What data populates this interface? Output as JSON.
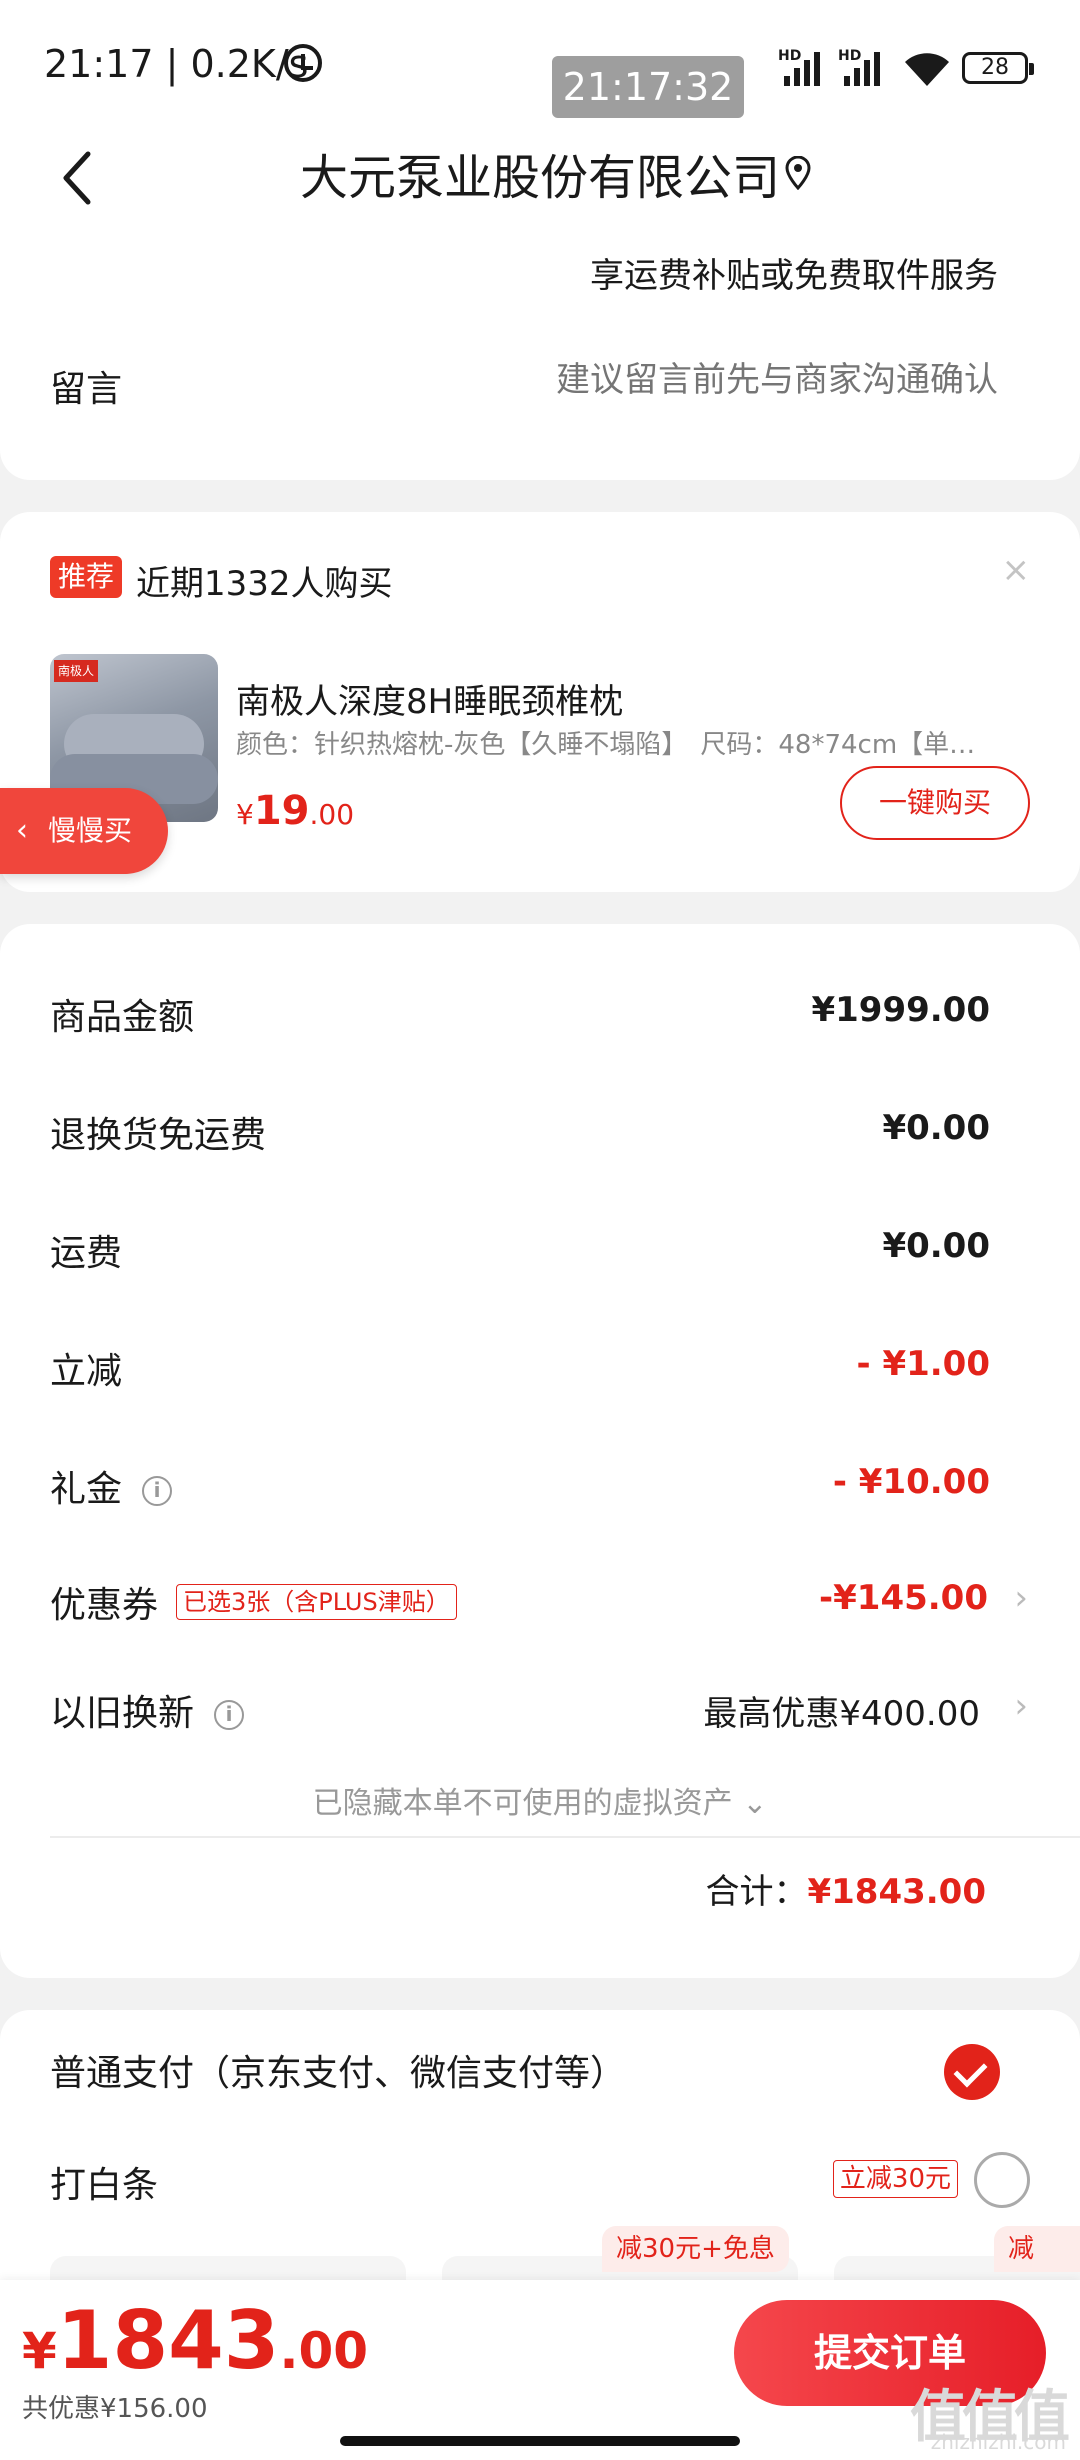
{
  "status_bar": {
    "time": "21:17 | 0.2K/s",
    "timestamp_chip": "21:17:32",
    "battery": "28"
  },
  "header": {
    "title": "大元泵业股份有限公司"
  },
  "shipping": {
    "note": "享运费补贴或免费取件服务"
  },
  "message": {
    "label": "留言",
    "placeholder": "建议留言前先与商家沟通确认"
  },
  "recommend": {
    "badge": "推荐",
    "text": "近期1332人购买",
    "close": "×",
    "product_title": "南极人深度8H睡眠颈椎枕",
    "product_spec": "颜色：针织热熔枕-灰色【久睡不塌陷】　尺码：48*74cm【单…",
    "image_logo": "南极人",
    "price_symbol": "¥",
    "price_int": "19",
    "price_dec": ".00",
    "buy_label": "一键购买",
    "slow_buy_label": "慢慢买"
  },
  "summary": {
    "rows": [
      {
        "label": "商品金额",
        "value": "¥1999.00"
      },
      {
        "label": "退换货免运费",
        "value": "¥0.00"
      },
      {
        "label": "运费",
        "value": "¥0.00"
      },
      {
        "label": "立减",
        "value": "- ¥1.00"
      },
      {
        "label": "礼金",
        "value": "- ¥10.00"
      },
      {
        "label": "优惠券",
        "value": "-¥145.00",
        "tag": "已选3张（含PLUS津贴）"
      },
      {
        "label": "以旧换新",
        "value": "最高优惠¥400.00"
      }
    ],
    "hidden_note": "已隐藏本单不可使用的虚拟资产 ⌄",
    "total_label": "合计：",
    "total_value": "¥1843.00"
  },
  "payment": {
    "standard": "普通支付（京东支付、微信支付等）",
    "baitiao": "打白条",
    "baitiao_tag": "立减30元",
    "plan_tag_1": "减30元+免息",
    "plan_tag_2": "减"
  },
  "bottom": {
    "price_symbol": "¥",
    "price_int": "1843",
    "price_dec": ".00",
    "saving": "共优惠¥156.00",
    "submit": "提交订单"
  },
  "watermark": {
    "mark": "值值值",
    "site": "zhizhizhi.com"
  },
  "colors": {
    "accent": "#e2231a",
    "background": "#f2f2f2"
  }
}
